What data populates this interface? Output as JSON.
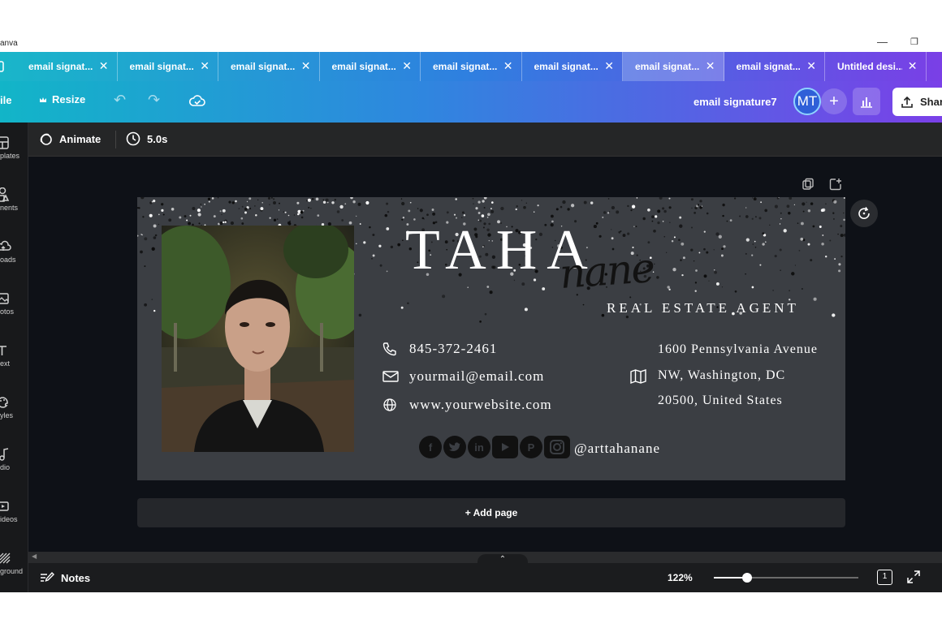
{
  "window": {
    "title": "anva"
  },
  "tabs": [
    {
      "label": "email signat..."
    },
    {
      "label": "email signat..."
    },
    {
      "label": "email signat..."
    },
    {
      "label": "email signat..."
    },
    {
      "label": "email signat..."
    },
    {
      "label": "email signat..."
    },
    {
      "label": "email signat...",
      "active": true
    },
    {
      "label": "email signat..."
    },
    {
      "label": "Untitled desi..."
    }
  ],
  "toolbar": {
    "file_label": "ile",
    "resize_label": "Resize",
    "doc_title": "email signature7",
    "avatar_initials": "MT",
    "share_label": "Shar"
  },
  "sidebar": {
    "items": [
      {
        "label": "plates",
        "icon": "templates-icon"
      },
      {
        "label": "nents",
        "icon": "elements-icon"
      },
      {
        "label": "oads",
        "icon": "uploads-icon"
      },
      {
        "label": "otos",
        "icon": "photos-icon"
      },
      {
        "label": "ext",
        "icon": "text-icon"
      },
      {
        "label": "yles",
        "icon": "styles-icon"
      },
      {
        "label": "dio",
        "icon": "audio-icon"
      },
      {
        "label": "ideos",
        "icon": "videos-icon"
      },
      {
        "label": "ground",
        "icon": "background-icon"
      }
    ]
  },
  "context_bar": {
    "animate_label": "Animate",
    "duration": "5.0s"
  },
  "design": {
    "name_first": "TAHA",
    "name_script": "nane",
    "role": "REAL ESTATE AGENT",
    "phone": "845-372-2461",
    "email": "yourmail@email.com",
    "website": "www.yourwebsite.com",
    "address_line1": "1600 Pennsylvania Avenue",
    "address_line2": "NW, Washington, DC",
    "address_line3": "20500, United States",
    "social_handle": "@arttahanane",
    "socials": [
      "facebook-icon",
      "twitter-icon",
      "linkedin-icon",
      "youtube-icon",
      "pinterest-icon",
      "instagram-icon"
    ],
    "background_color": "#3b3e43"
  },
  "add_page_label": "+ Add page",
  "bottom_bar": {
    "notes_label": "Notes",
    "zoom_label": "122%",
    "zoom_fraction": 0.23,
    "page_count": "1"
  },
  "colors": {
    "canvas_bg": "#0e1117",
    "tab_gradient_start": "#19b6c9",
    "tab_gradient_end": "#7a3fe6"
  }
}
